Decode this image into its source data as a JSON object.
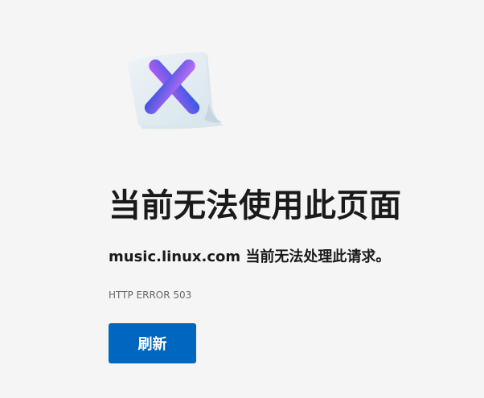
{
  "page": {
    "title": "当前无法使用此页面",
    "message": "music.linux.com 当前无法处理此请求。",
    "error_code": "HTTP ERROR 503",
    "refresh_label": "刷新"
  },
  "illustration": {
    "icon": "error-document-x-icon"
  },
  "colors": {
    "background": "#f5f5f5",
    "text": "#1a1a1a",
    "muted_text": "#666666",
    "accent": "#0067c0",
    "x_gradient_start": "#b45cf0",
    "x_gradient_end": "#2f5be6"
  }
}
